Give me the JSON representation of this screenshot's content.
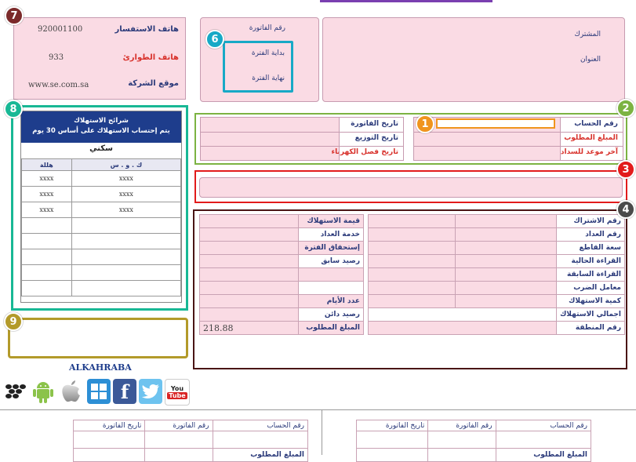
{
  "top_bar_color": "#7a3fb0",
  "contact": {
    "inquiry_phone_label": "هاتف الاستفسار",
    "inquiry_phone": "920001100",
    "emergency_phone_label": "هاتف الطوارئ",
    "emergency_phone": "933",
    "website_label": "موقع الشركة",
    "website": "www.se.com.sa"
  },
  "invoice_period": {
    "invoice_number_label": "رقم الفاتورة",
    "period_start_label": "بداية الفترة",
    "period_end_label": "نهاية الفترة"
  },
  "subscriber": {
    "subscriber_label": "المشترك",
    "address_label": "العنوان"
  },
  "section2": {
    "account_number_label": "رقم الحساب",
    "amount_due_label": "المبلغ المطلوب",
    "last_payment_date_label": "آخر موعد للسداد",
    "invoice_date_label": "تاريخ الفاتورة",
    "distribution_date_label": "تاريخ التوزيع",
    "disconnection_date_label": "تاريخ فصل الكهرباء"
  },
  "consumption_tiers": {
    "title_line1": "شرائح الاستهلاك",
    "title_line2": "يتم إحتساب الاستهلاك على أساس 30 يوم",
    "category": "سكني",
    "col_kwh": "ك . و . س",
    "col_halala": "هللة",
    "rows": [
      {
        "kwh": "xxxx",
        "halala": "xxxx"
      },
      {
        "kwh": "xxxx",
        "halala": "xxxx"
      },
      {
        "kwh": "xxxx",
        "halala": "xxxx"
      },
      {
        "kwh": "",
        "halala": ""
      },
      {
        "kwh": "",
        "halala": ""
      },
      {
        "kwh": "",
        "halala": ""
      },
      {
        "kwh": "",
        "halala": ""
      },
      {
        "kwh": "",
        "halala": ""
      }
    ]
  },
  "meter_details": {
    "right_labels": [
      "رقم الاشتراك",
      "رقم العداد",
      "سعة القاطع",
      "القراءة الحالية",
      "القراءة السابقة",
      "معامل الضرب",
      "كمية الاستهلاك",
      "اجمالي الاستهلاك",
      "رقم المنطقة"
    ],
    "left_labels": [
      "قيمة الاستهلاك",
      "خدمة العداد",
      "إستحقاق الفترة",
      "رصيد سابق",
      "",
      "",
      "عدد الأيام",
      "رصيد دائن",
      "المبلغ المطلوب"
    ],
    "amount_due_value": "218.88"
  },
  "brand": "ALKAHRABA",
  "app_icons": [
    "blackberry-icon",
    "android-icon",
    "apple-icon",
    "windows-icon",
    "facebook-icon",
    "twitter-icon",
    "youtube-icon"
  ],
  "youtube_text_top": "You",
  "youtube_text_bottom": "Tube",
  "stub_left": {
    "account_number_label": "رقم الحساب",
    "invoice_number_label": "رقم الفاتورة",
    "invoice_date_label": "تاريخ الفاتورة",
    "amount_due_label": "المبلغ المطلوب"
  },
  "stub_right": {
    "account_number_label": "رقم الحساب",
    "invoice_number_label": "رقم الفاتورة",
    "invoice_date_label": "تاريخ الفاتورة",
    "amount_due_label": "المبلغ المطلوب"
  },
  "badges": [
    "1",
    "2",
    "3",
    "4",
    "6",
    "7",
    "8",
    "9"
  ],
  "badge_colors": {
    "1": "#f0941e",
    "2": "#7cb342",
    "3": "#e21b1b",
    "4": "#4a4a4a",
    "6": "#17a9c6",
    "7": "#7b2a2a",
    "8": "#18b895",
    "9": "#b39a2a"
  }
}
